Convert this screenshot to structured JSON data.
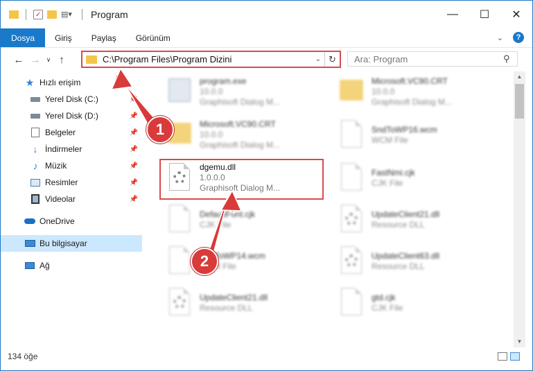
{
  "window": {
    "title": "Program"
  },
  "ribbon": {
    "tabs": [
      "Dosya",
      "Giriş",
      "Paylaş",
      "Görünüm"
    ]
  },
  "address": {
    "path": "C:\\Program Files\\Program Dizini"
  },
  "search": {
    "placeholder": "Ara: Program"
  },
  "sidebar": {
    "items": [
      {
        "label": "Hızlı erişim",
        "icon": "star-icon"
      },
      {
        "label": "Yerel Disk (C:)",
        "icon": "drive-icon",
        "pinned": true
      },
      {
        "label": "Yerel Disk (D:)",
        "icon": "drive-icon",
        "pinned": true
      },
      {
        "label": "Belgeler",
        "icon": "documents-icon",
        "pinned": true
      },
      {
        "label": "İndirmeler",
        "icon": "download-icon",
        "pinned": true
      },
      {
        "label": "Müzik",
        "icon": "music-icon",
        "pinned": true
      },
      {
        "label": "Resimler",
        "icon": "pictures-icon",
        "pinned": true
      },
      {
        "label": "Videolar",
        "icon": "videos-icon",
        "pinned": true
      },
      {
        "label": "OneDrive",
        "icon": "cloud-icon"
      },
      {
        "label": "Bu bilgisayar",
        "icon": "computer-icon",
        "selected": true
      },
      {
        "label": "Ağ",
        "icon": "network-icon"
      }
    ]
  },
  "files": [
    {
      "name": "program.exe",
      "line2": "10.0.0",
      "line3": "Graphisoft Dialog M...",
      "icon": "exe-icon",
      "blurred": true
    },
    {
      "name": "Microsoft.VC90.CRT",
      "line2": "10.0.0",
      "line3": "Graphisoft Dialog M...",
      "icon": "folder-icon",
      "blurred": true
    },
    {
      "name": "Microsoft.VC90.CRT",
      "line2": "10.0.0",
      "line3": "Graphisoft Dialog M...",
      "icon": "folder-icon",
      "blurred": true
    },
    {
      "name": "SndToWP16.wcm",
      "line2": "WCM File",
      "line3": "",
      "icon": "document-icon",
      "blurred": true
    },
    {
      "name": "dgemu.dll",
      "line2": "1.0.0.0",
      "line3": "Graphisoft Dialog M...",
      "icon": "dll-gear-icon",
      "blurred": false
    },
    {
      "name": "FastNmi.cjk",
      "line2": "CJK File",
      "line3": "",
      "icon": "document-icon",
      "blurred": true
    },
    {
      "name": "DefaultFont.cjk",
      "line2": "CJK File",
      "line3": "",
      "icon": "document-icon",
      "blurred": true
    },
    {
      "name": "UpdateClient21.dll",
      "line2": "Resource DLL",
      "line3": "",
      "icon": "dll-gear-icon",
      "blurred": true
    },
    {
      "name": "SndToWP14.wcm",
      "line2": "WCM File",
      "line3": "",
      "icon": "document-icon",
      "blurred": true
    },
    {
      "name": "UpdateClient63.dll",
      "line2": "Resource DLL",
      "line3": "",
      "icon": "dll-gear-icon",
      "blurred": true
    },
    {
      "name": "UpdateClient21.dll",
      "line2": "Resource DLL",
      "line3": "",
      "icon": "dll-gear-icon",
      "blurred": true
    },
    {
      "name": "gtd.cjk",
      "line2": "CJK File",
      "line3": "",
      "icon": "document-icon",
      "blurred": true
    }
  ],
  "annotations": {
    "step1": "1",
    "step2": "2"
  },
  "status": {
    "count": "134 öğe"
  },
  "colors": {
    "accent": "#1979ca",
    "highlight": "#d94a4a",
    "selected": "#cce8ff"
  }
}
